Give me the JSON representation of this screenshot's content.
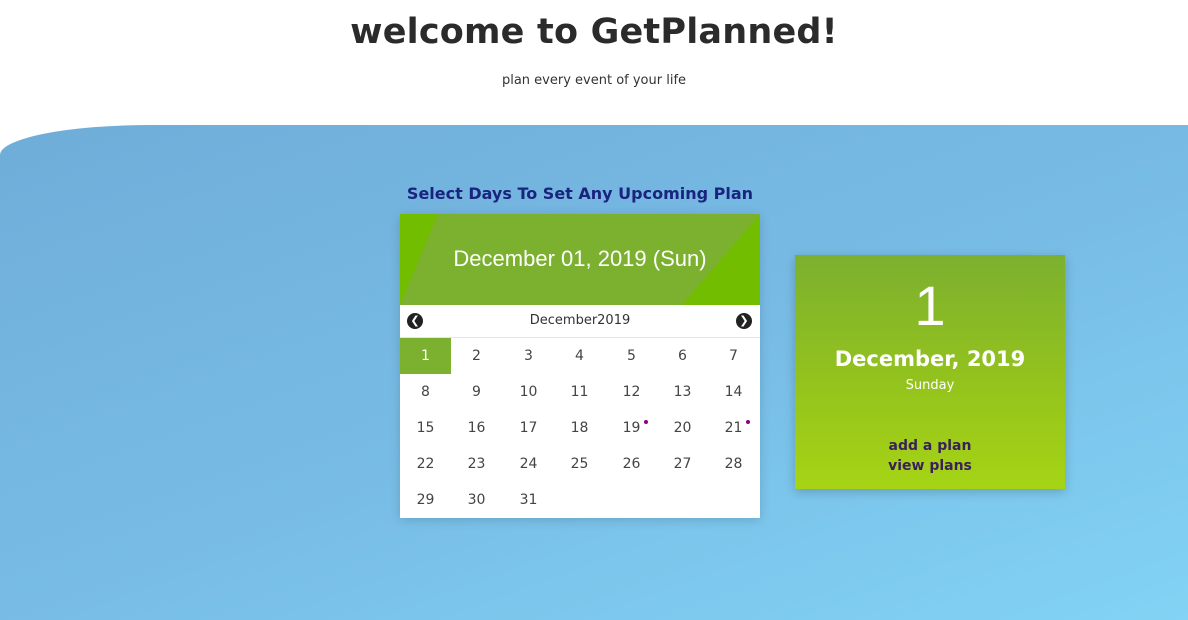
{
  "header": {
    "title": "welcome to GetPlanned!",
    "subtitle": "plan every event of your life"
  },
  "calendar": {
    "section_title": "Select Days To Set Any Upcoming Plan",
    "selected_date_display": "December 01, 2019 (Sun)",
    "month_label": "December2019",
    "prev_icon": "chevron-left-circle-icon",
    "next_icon": "chevron-right-circle-icon",
    "prev_glyph": "❮",
    "next_glyph": "❯",
    "selected_day": "1",
    "days_with_plans": [
      "19",
      "21"
    ],
    "weeks": [
      [
        "1",
        "2",
        "3",
        "4",
        "5",
        "6",
        "7"
      ],
      [
        "8",
        "9",
        "10",
        "11",
        "12",
        "13",
        "14"
      ],
      [
        "15",
        "16",
        "17",
        "18",
        "19",
        "20",
        "21"
      ],
      [
        "22",
        "23",
        "24",
        "25",
        "26",
        "27",
        "28"
      ],
      [
        "29",
        "30",
        "31"
      ]
    ]
  },
  "detail_card": {
    "day_number": "1",
    "month_year": "December, 2019",
    "weekday": "Sunday",
    "add_plan_label": "add a plan",
    "view_plans_label": "view plans"
  },
  "colors": {
    "accent_green": "#7cb02f",
    "band_blue": "#78bde6",
    "title_navy": "#1a237e",
    "plan_dot": "#8b008b",
    "link_purple": "#3b1f5c"
  }
}
